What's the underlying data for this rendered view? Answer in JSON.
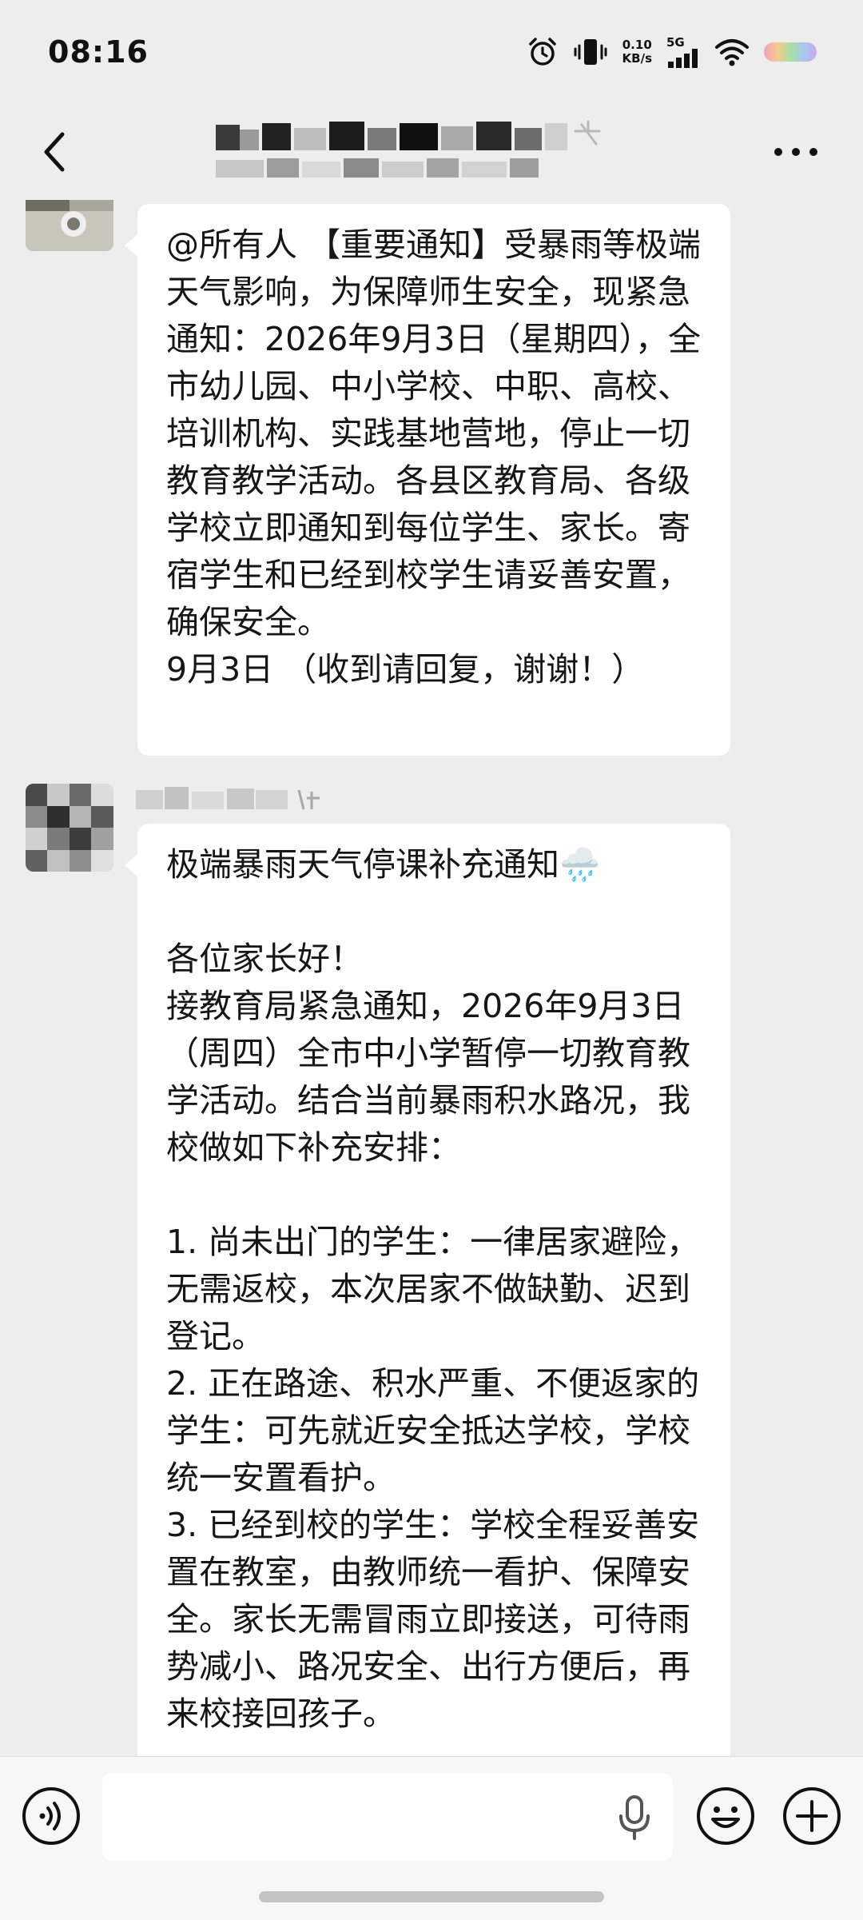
{
  "status_bar": {
    "time": "08:16",
    "net_speed_value": "0.10",
    "net_speed_unit": "KB/s",
    "network_type": "5G"
  },
  "header": {
    "title": "",
    "subtitle": ""
  },
  "messages": [
    {
      "sender": "",
      "text": "@所有人 【重要通知】受暴雨等极端天气影响，为保障师生安全，现紧急通知：2026年9月3日（星期四），全市幼儿园、中小学校、中职、高校、培训机构、实践基地营地，停止一切教育教学活动。各县区教育局、各级学校立即通知到每位学生、家长。寄宿学生和已经到校学生请妥善安置，确保安全。\n9月3日 （收到请回复，谢谢！）"
    },
    {
      "sender": "",
      "text": "极端暴雨天气停课补充通知🌧️\n\n各位家长好！\n接教育局紧急通知，2026年9月3日（周四）全市中小学暂停一切教育教学活动。结合当前暴雨积水路况，我校做如下补充安排：\n\n1. 尚未出门的学生：一律居家避险，无需返校，本次居家不做缺勤、迟到登记。\n2. 正在路途、积水严重、不便返家的学生：可先就近安全抵达学校，学校统一安置看护。\n3. 已经到校的学生：学校全程妥善安置在教室，由教师统一看护、保障安全。家长无需冒雨立即接送，可待雨势减小、路况安全、出行方便后，再来校接回孩子。"
    }
  ],
  "input_bar": {
    "placeholder": "",
    "value": ""
  },
  "icons": {
    "back": "chevron-left-icon",
    "more": "more-horizontal-icon",
    "voice": "voice-icon",
    "mic": "mic-icon",
    "emoji": "emoji-icon",
    "plus": "plus-icon"
  }
}
